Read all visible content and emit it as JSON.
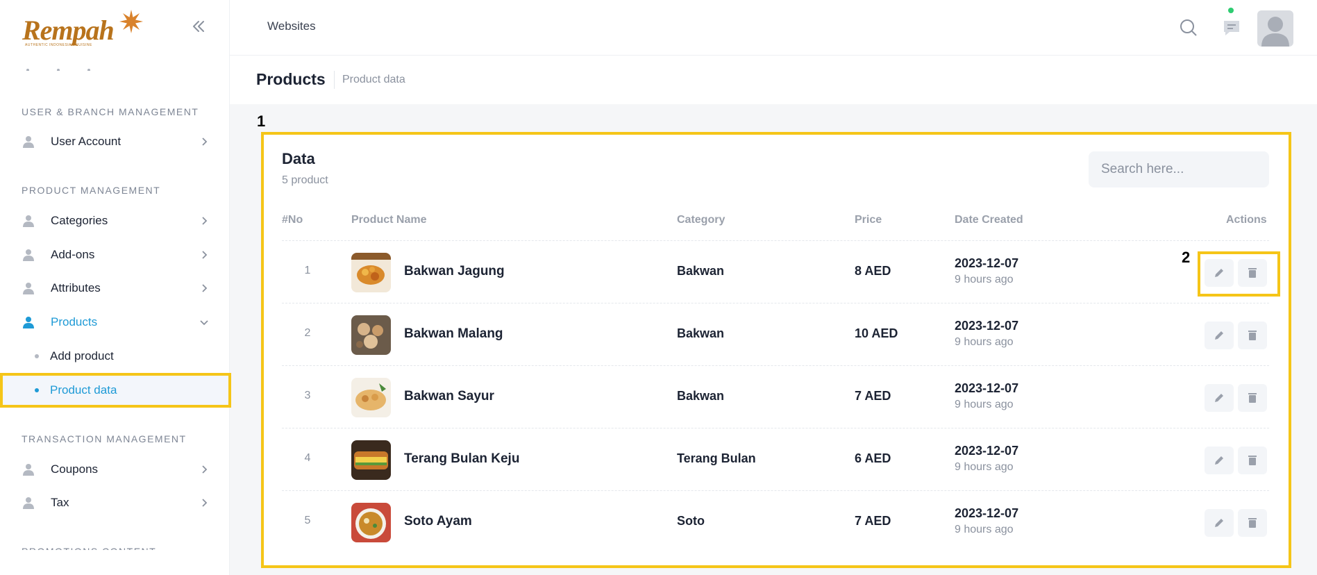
{
  "brand": {
    "logo_text": "Rempah",
    "logo_tagline": "AUTHENTIC INDONESIAN CUISINE"
  },
  "sidebar": {
    "sections": [
      {
        "title": "USER & BRANCH MANAGEMENT"
      },
      {
        "title": "PRODUCT MANAGEMENT"
      },
      {
        "title": "TRANSACTION MANAGEMENT"
      },
      {
        "title": "PROMOTIONS CONTENT"
      }
    ],
    "items": [
      {
        "label": "User Account"
      },
      {
        "label": "Categories"
      },
      {
        "label": "Add-ons"
      },
      {
        "label": "Attributes"
      },
      {
        "label": "Products"
      },
      {
        "label": "Coupons"
      },
      {
        "label": "Tax"
      }
    ],
    "subitems": [
      {
        "label": "Add product"
      },
      {
        "label": "Product data"
      }
    ],
    "accent_color": "#1e9ad6"
  },
  "header": {
    "site_label": "Websites"
  },
  "page": {
    "title": "Products",
    "breadcrumb": "Product data"
  },
  "markers": {
    "m1": "1",
    "m2": "2"
  },
  "card": {
    "title": "Data",
    "subtitle": "5 product",
    "search_placeholder": "Search here...",
    "columns": [
      "#No",
      "Product Name",
      "Category",
      "Price",
      "Date Created",
      "Actions"
    ],
    "rows": [
      {
        "no": "1",
        "name": "Bakwan Jagung",
        "category": "Bakwan",
        "price": "8 AED",
        "date": "2023-12-07",
        "ago": "9 hours ago"
      },
      {
        "no": "2",
        "name": "Bakwan Malang",
        "category": "Bakwan",
        "price": "10 AED",
        "date": "2023-12-07",
        "ago": "9 hours ago"
      },
      {
        "no": "3",
        "name": "Bakwan Sayur",
        "category": "Bakwan",
        "price": "7 AED",
        "date": "2023-12-07",
        "ago": "9 hours ago"
      },
      {
        "no": "4",
        "name": "Terang Bulan Keju",
        "category": "Terang Bulan",
        "price": "6 AED",
        "date": "2023-12-07",
        "ago": "9 hours ago"
      },
      {
        "no": "5",
        "name": "Soto Ayam",
        "category": "Soto",
        "price": "7 AED",
        "date": "2023-12-07",
        "ago": "9 hours ago"
      }
    ]
  },
  "highlight_color": "#f5c518"
}
